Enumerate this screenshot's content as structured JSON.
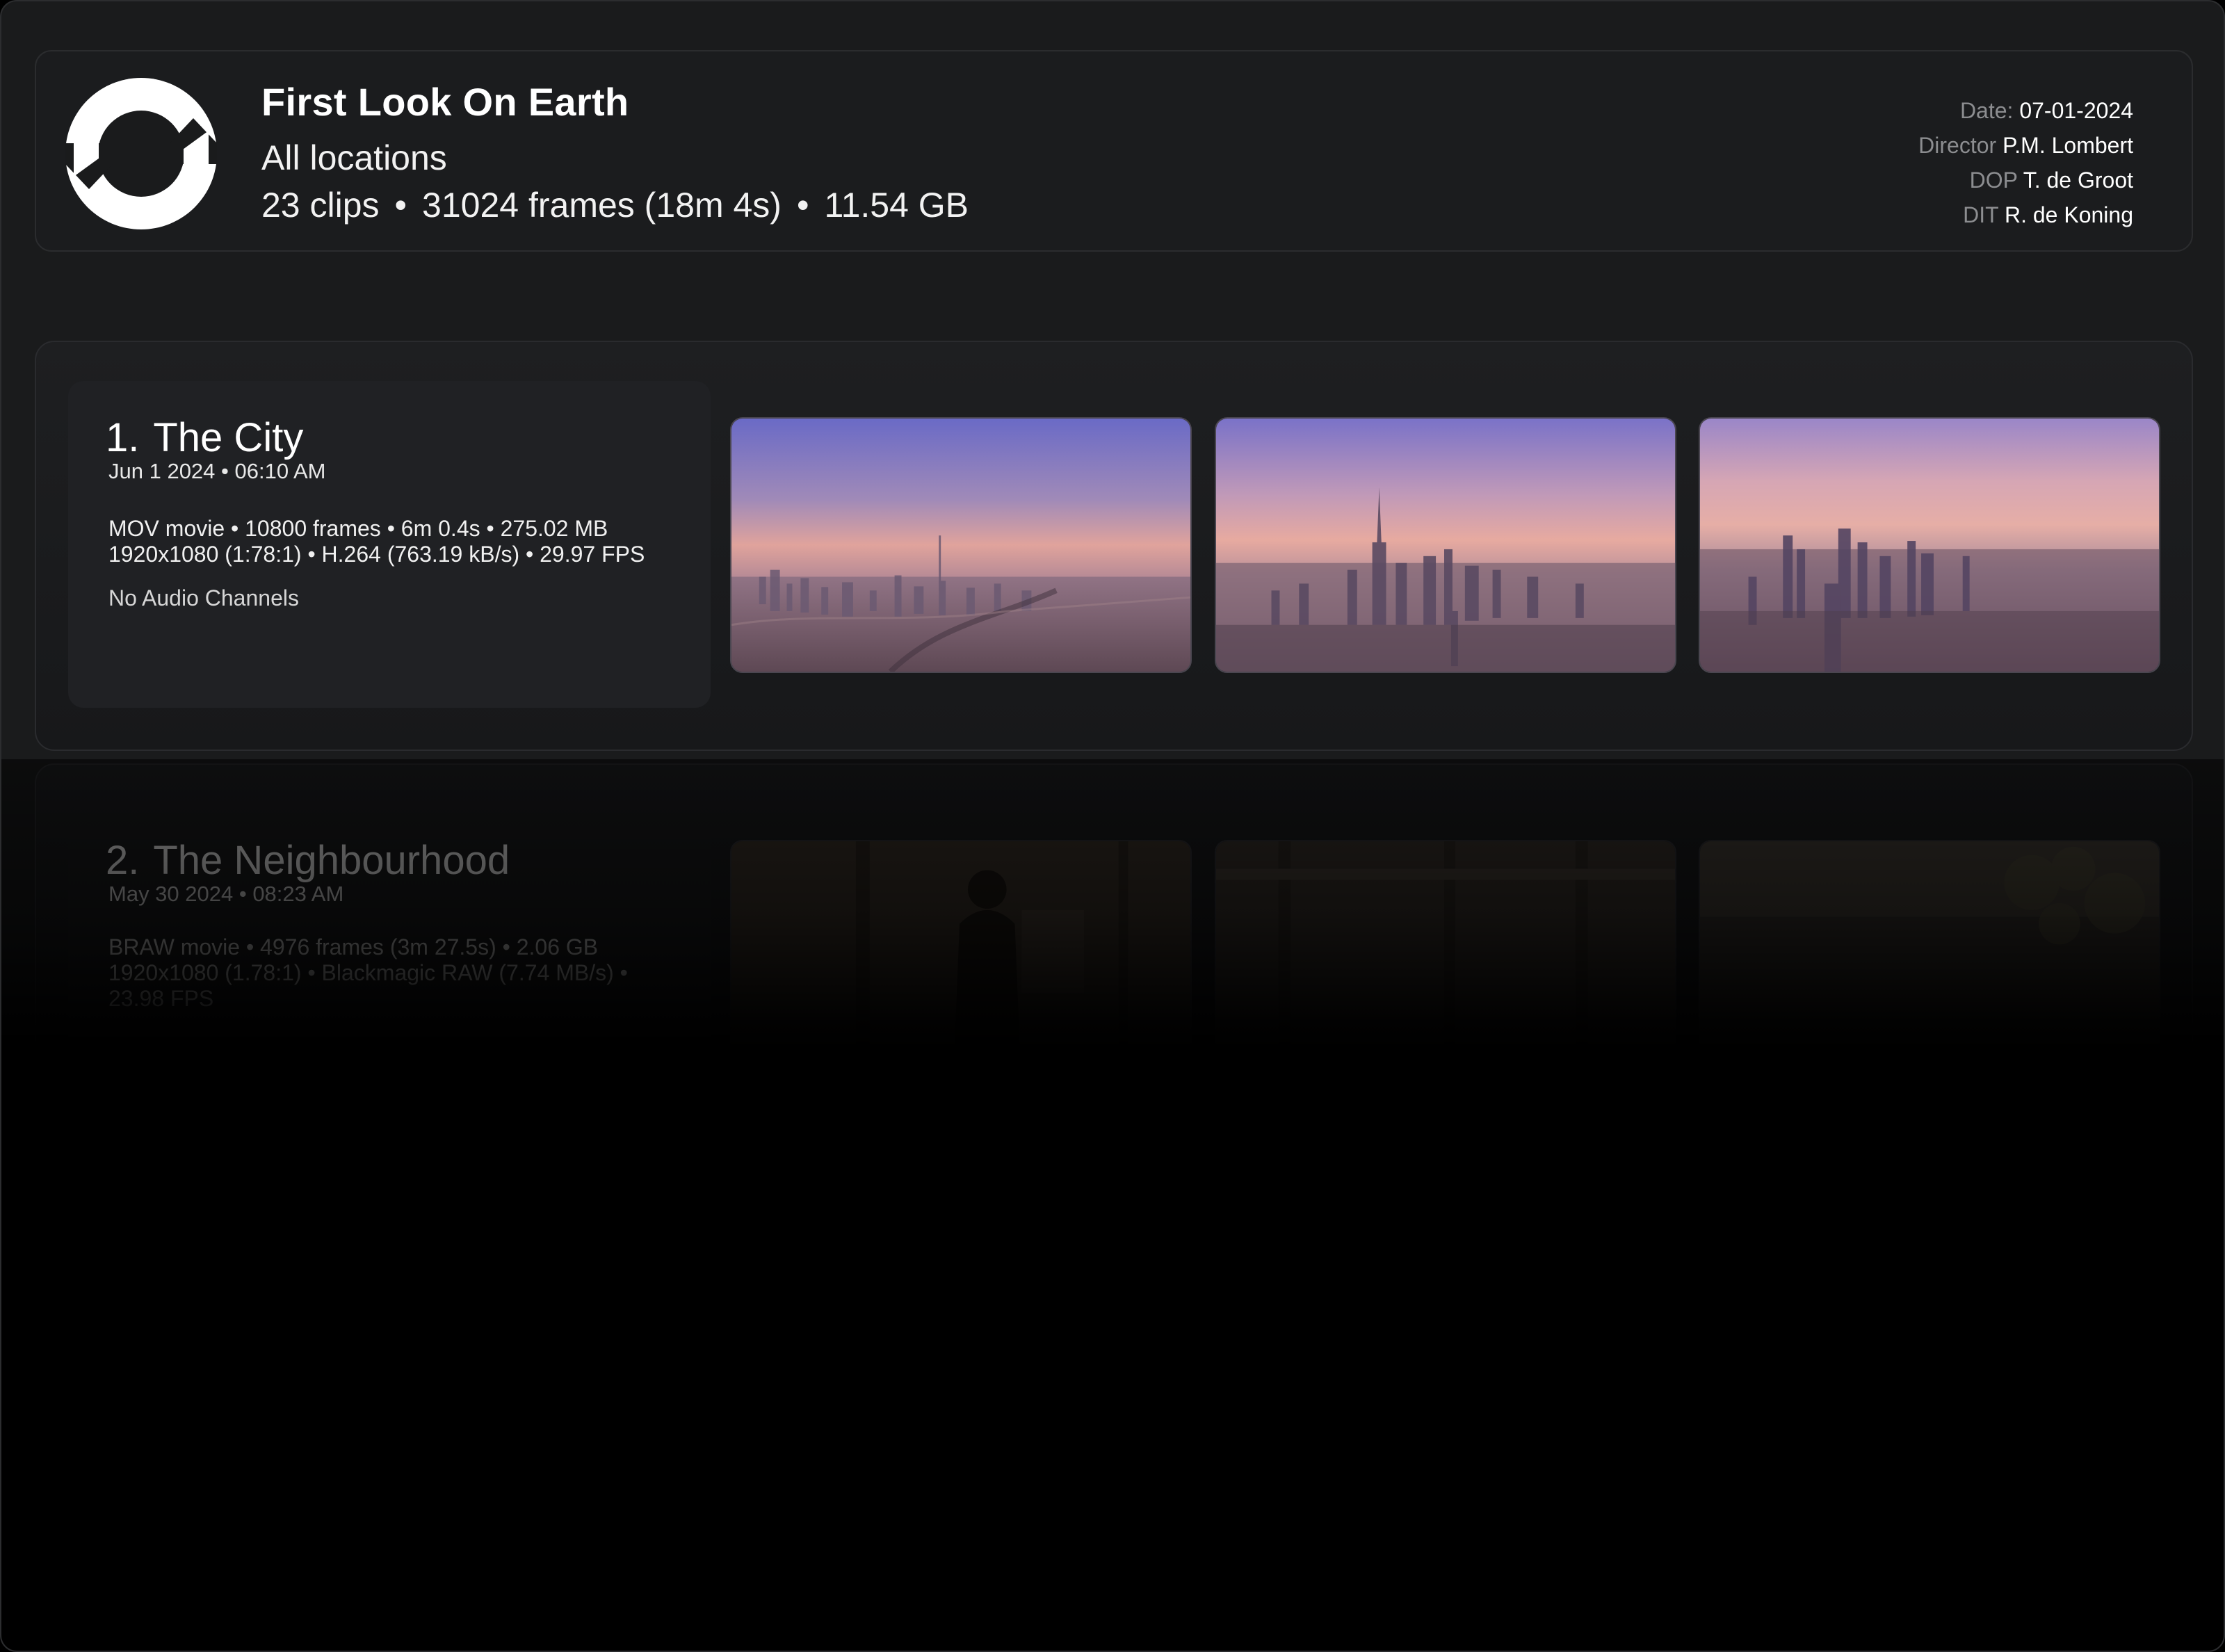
{
  "project": {
    "title": "First Look On Earth",
    "subtitle": "All locations",
    "stats": {
      "clips": "23 clips",
      "frames": "31024 frames (18m 4s)",
      "size": "11.54 GB",
      "separator": "•"
    },
    "meta": [
      {
        "key": "Date:",
        "value": "07-01-2024"
      },
      {
        "key": "Director",
        "value": "P.M. Lombert"
      },
      {
        "key": "DOP",
        "value": "T. de Groot"
      },
      {
        "key": "DIT",
        "value": "R. de Koning"
      }
    ],
    "logo_icon": "sync-arrows-icon"
  },
  "clips": [
    {
      "number": "1.",
      "name": "The City",
      "date": "Jun 1 2024 • 06:10 AM",
      "spec_line1": "MOV movie •  10800 frames • 6m 0.4s • 275.02 MB",
      "spec_line2": "1920x1080 (1:78:1) • H.264 (763.19 kB/s) • 29.97 FPS",
      "audio": "No Audio Channels",
      "thumbnails": [
        "city-aerial-1",
        "city-aerial-2",
        "city-aerial-3"
      ]
    },
    {
      "number": "2.",
      "name": "The Neighbourhood",
      "date": "May 30 2024 • 08:23 AM",
      "spec_line1": "BRAW movie • 4976 frames (3m 27.5s) • 2.06 GB",
      "spec_line2": "1920x1080 (1.78:1) • Blackmagic RAW (7.74 MB/s) •",
      "spec_line3": "23.98 FPS",
      "thumbnails": [
        "interior-window-1",
        "interior-window-2",
        "interior-window-3"
      ]
    }
  ],
  "colors": {
    "background": "#1a1b1c",
    "card": "#1e1f21",
    "muted_text": "#8c8d90",
    "sky_top": "#6f6fc4",
    "sky_horizon": "#e8a59a"
  }
}
